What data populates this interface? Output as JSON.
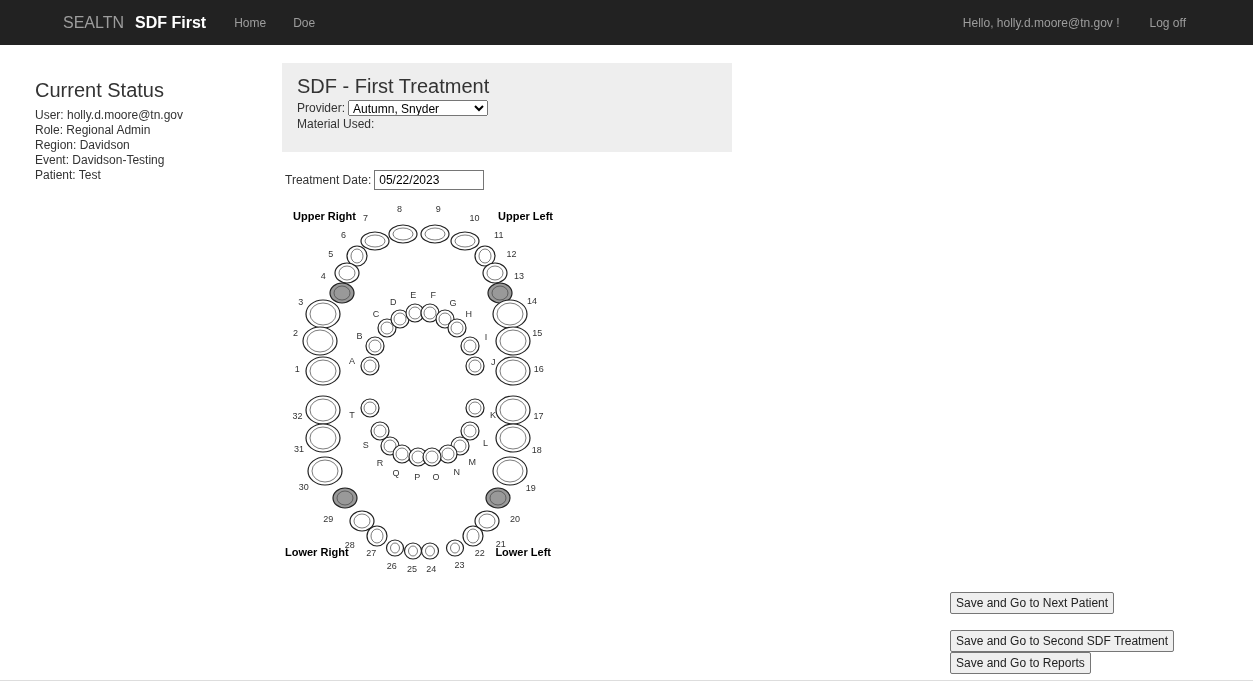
{
  "navbar": {
    "brand": "SEALTN",
    "app_title": "SDF First",
    "links": [
      "Home",
      "Doe"
    ],
    "greeting": "Hello, holly.d.moore@tn.gov !",
    "logoff": "Log off"
  },
  "status": {
    "title": "Current Status",
    "lines": [
      "User: holly.d.moore@tn.gov",
      "Role: Regional Admin",
      "Region: Davidson",
      "Event: Davidson-Testing",
      "Patient: Test"
    ]
  },
  "form": {
    "title": "SDF - First Treatment",
    "provider_label": "Provider:",
    "provider_value": "Autumn, Snyder",
    "material_label": "Material Used:",
    "date_label": "Treatment Date:",
    "date_value": "05/22/2023"
  },
  "chart": {
    "quadrants": [
      {
        "name": "Upper Right",
        "permanent_teeth": [
          {
            "label": "8",
            "selected": false
          },
          {
            "label": "7",
            "selected": false
          },
          {
            "label": "6",
            "selected": false
          },
          {
            "label": "5",
            "selected": false
          },
          {
            "label": "4",
            "selected": true
          },
          {
            "label": "3",
            "selected": false
          },
          {
            "label": "2",
            "selected": false
          },
          {
            "label": "1",
            "selected": false
          }
        ],
        "primary_teeth": [
          {
            "label": "A",
            "selected": false
          },
          {
            "label": "B",
            "selected": false
          },
          {
            "label": "C",
            "selected": false
          },
          {
            "label": "D",
            "selected": false
          },
          {
            "label": "E",
            "selected": false
          }
        ]
      },
      {
        "name": "Upper Left",
        "permanent_teeth": [
          {
            "label": "9",
            "selected": false
          },
          {
            "label": "10",
            "selected": false
          },
          {
            "label": "11",
            "selected": false
          },
          {
            "label": "12",
            "selected": false
          },
          {
            "label": "13",
            "selected": true
          },
          {
            "label": "14",
            "selected": false
          },
          {
            "label": "15",
            "selected": false
          },
          {
            "label": "16",
            "selected": false
          }
        ],
        "primary_teeth": [
          {
            "label": "F",
            "selected": false
          },
          {
            "label": "G",
            "selected": false
          },
          {
            "label": "H",
            "selected": false
          },
          {
            "label": "I",
            "selected": false
          },
          {
            "label": "J",
            "selected": false
          }
        ]
      },
      {
        "name": "Lower Right",
        "permanent_teeth": [
          {
            "label": "32",
            "selected": false
          },
          {
            "label": "31",
            "selected": false
          },
          {
            "label": "30",
            "selected": false
          },
          {
            "label": "29",
            "selected": true
          },
          {
            "label": "28",
            "selected": false
          },
          {
            "label": "27",
            "selected": false
          },
          {
            "label": "26",
            "selected": false
          },
          {
            "label": "25",
            "selected": false
          }
        ],
        "primary_teeth": [
          {
            "label": "T",
            "selected": false
          },
          {
            "label": "S",
            "selected": false
          },
          {
            "label": "R",
            "selected": false
          },
          {
            "label": "Q",
            "selected": false
          },
          {
            "label": "P",
            "selected": false
          }
        ]
      },
      {
        "name": "Lower Left",
        "permanent_teeth": [
          {
            "label": "17",
            "selected": false
          },
          {
            "label": "18",
            "selected": false
          },
          {
            "label": "19",
            "selected": false
          },
          {
            "label": "20",
            "selected": true
          },
          {
            "label": "21",
            "selected": false
          },
          {
            "label": "22",
            "selected": false
          },
          {
            "label": "23",
            "selected": false
          },
          {
            "label": "24",
            "selected": false
          }
        ],
        "primary_teeth": [
          {
            "label": "K",
            "selected": false
          },
          {
            "label": "L",
            "selected": false
          },
          {
            "label": "M",
            "selected": false
          },
          {
            "label": "N",
            "selected": false
          },
          {
            "label": "O",
            "selected": false
          }
        ]
      }
    ]
  },
  "buttons": [
    "Save and Go to Next Patient",
    "Save and Go to Second SDF Treatment",
    "Save and Go to Reports"
  ]
}
